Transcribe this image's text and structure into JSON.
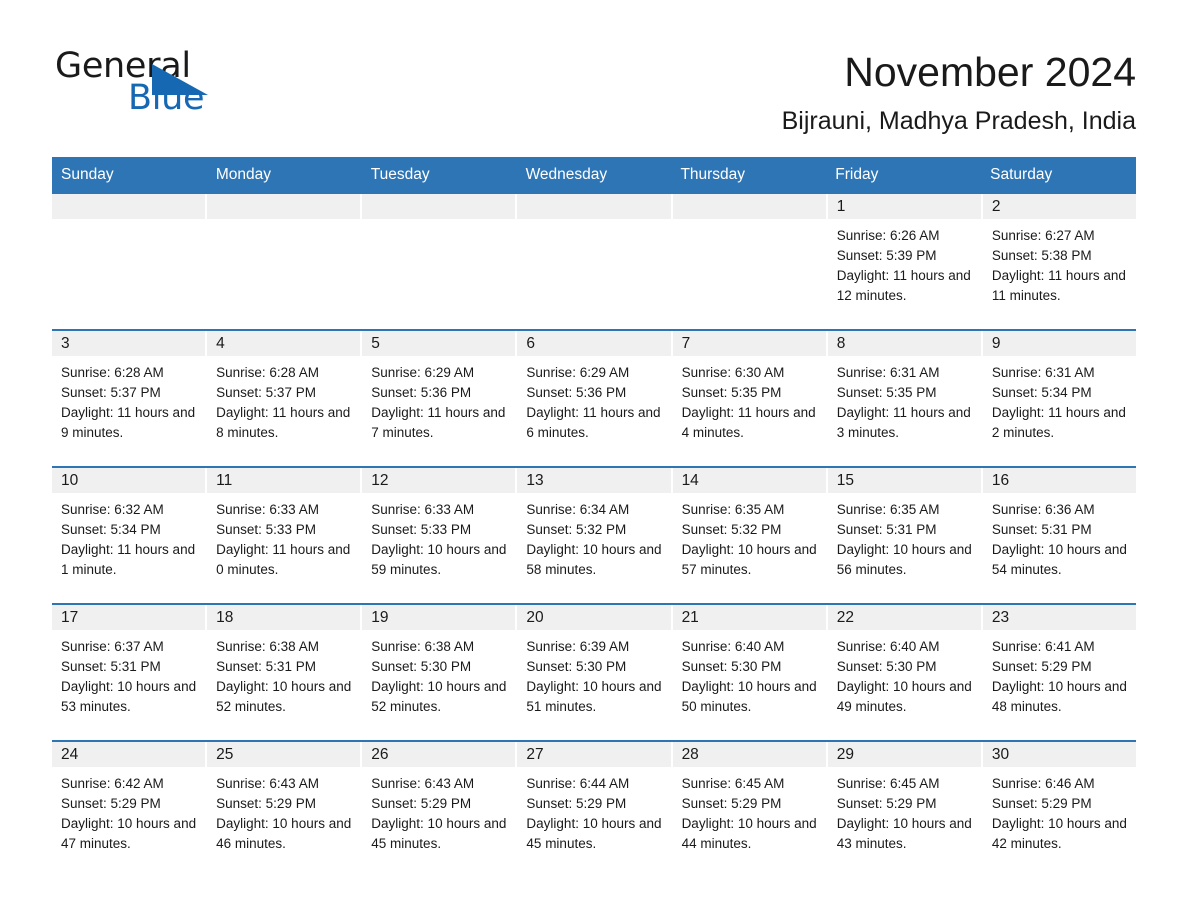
{
  "logo": {
    "word1": "General",
    "word2": "Blue",
    "triangle_color": "#1668b3",
    "icon": "triangle-icon"
  },
  "header": {
    "title": "November 2024",
    "subtitle": "Bijrauni, Madhya Pradesh, India"
  },
  "theme": {
    "header_blue": "#2e75b6",
    "daynum_gray": "#f0f0f0",
    "text": "#1a1a1a"
  },
  "calendar": {
    "weekdays": [
      "Sunday",
      "Monday",
      "Tuesday",
      "Wednesday",
      "Thursday",
      "Friday",
      "Saturday"
    ],
    "labels": {
      "sunrise": "Sunrise:",
      "sunset": "Sunset:",
      "daylight": "Daylight:"
    },
    "weeks": [
      [
        {
          "day": "",
          "sunrise": "",
          "sunset": "",
          "daylight": ""
        },
        {
          "day": "",
          "sunrise": "",
          "sunset": "",
          "daylight": ""
        },
        {
          "day": "",
          "sunrise": "",
          "sunset": "",
          "daylight": ""
        },
        {
          "day": "",
          "sunrise": "",
          "sunset": "",
          "daylight": ""
        },
        {
          "day": "",
          "sunrise": "",
          "sunset": "",
          "daylight": ""
        },
        {
          "day": "1",
          "sunrise": "Sunrise: 6:26 AM",
          "sunset": "Sunset: 5:39 PM",
          "daylight": "Daylight: 11 hours and 12 minutes."
        },
        {
          "day": "2",
          "sunrise": "Sunrise: 6:27 AM",
          "sunset": "Sunset: 5:38 PM",
          "daylight": "Daylight: 11 hours and 11 minutes."
        }
      ],
      [
        {
          "day": "3",
          "sunrise": "Sunrise: 6:28 AM",
          "sunset": "Sunset: 5:37 PM",
          "daylight": "Daylight: 11 hours and 9 minutes."
        },
        {
          "day": "4",
          "sunrise": "Sunrise: 6:28 AM",
          "sunset": "Sunset: 5:37 PM",
          "daylight": "Daylight: 11 hours and 8 minutes."
        },
        {
          "day": "5",
          "sunrise": "Sunrise: 6:29 AM",
          "sunset": "Sunset: 5:36 PM",
          "daylight": "Daylight: 11 hours and 7 minutes."
        },
        {
          "day": "6",
          "sunrise": "Sunrise: 6:29 AM",
          "sunset": "Sunset: 5:36 PM",
          "daylight": "Daylight: 11 hours and 6 minutes."
        },
        {
          "day": "7",
          "sunrise": "Sunrise: 6:30 AM",
          "sunset": "Sunset: 5:35 PM",
          "daylight": "Daylight: 11 hours and 4 minutes."
        },
        {
          "day": "8",
          "sunrise": "Sunrise: 6:31 AM",
          "sunset": "Sunset: 5:35 PM",
          "daylight": "Daylight: 11 hours and 3 minutes."
        },
        {
          "day": "9",
          "sunrise": "Sunrise: 6:31 AM",
          "sunset": "Sunset: 5:34 PM",
          "daylight": "Daylight: 11 hours and 2 minutes."
        }
      ],
      [
        {
          "day": "10",
          "sunrise": "Sunrise: 6:32 AM",
          "sunset": "Sunset: 5:34 PM",
          "daylight": "Daylight: 11 hours and 1 minute."
        },
        {
          "day": "11",
          "sunrise": "Sunrise: 6:33 AM",
          "sunset": "Sunset: 5:33 PM",
          "daylight": "Daylight: 11 hours and 0 minutes."
        },
        {
          "day": "12",
          "sunrise": "Sunrise: 6:33 AM",
          "sunset": "Sunset: 5:33 PM",
          "daylight": "Daylight: 10 hours and 59 minutes."
        },
        {
          "day": "13",
          "sunrise": "Sunrise: 6:34 AM",
          "sunset": "Sunset: 5:32 PM",
          "daylight": "Daylight: 10 hours and 58 minutes."
        },
        {
          "day": "14",
          "sunrise": "Sunrise: 6:35 AM",
          "sunset": "Sunset: 5:32 PM",
          "daylight": "Daylight: 10 hours and 57 minutes."
        },
        {
          "day": "15",
          "sunrise": "Sunrise: 6:35 AM",
          "sunset": "Sunset: 5:31 PM",
          "daylight": "Daylight: 10 hours and 56 minutes."
        },
        {
          "day": "16",
          "sunrise": "Sunrise: 6:36 AM",
          "sunset": "Sunset: 5:31 PM",
          "daylight": "Daylight: 10 hours and 54 minutes."
        }
      ],
      [
        {
          "day": "17",
          "sunrise": "Sunrise: 6:37 AM",
          "sunset": "Sunset: 5:31 PM",
          "daylight": "Daylight: 10 hours and 53 minutes."
        },
        {
          "day": "18",
          "sunrise": "Sunrise: 6:38 AM",
          "sunset": "Sunset: 5:31 PM",
          "daylight": "Daylight: 10 hours and 52 minutes."
        },
        {
          "day": "19",
          "sunrise": "Sunrise: 6:38 AM",
          "sunset": "Sunset: 5:30 PM",
          "daylight": "Daylight: 10 hours and 52 minutes."
        },
        {
          "day": "20",
          "sunrise": "Sunrise: 6:39 AM",
          "sunset": "Sunset: 5:30 PM",
          "daylight": "Daylight: 10 hours and 51 minutes."
        },
        {
          "day": "21",
          "sunrise": "Sunrise: 6:40 AM",
          "sunset": "Sunset: 5:30 PM",
          "daylight": "Daylight: 10 hours and 50 minutes."
        },
        {
          "day": "22",
          "sunrise": "Sunrise: 6:40 AM",
          "sunset": "Sunset: 5:30 PM",
          "daylight": "Daylight: 10 hours and 49 minutes."
        },
        {
          "day": "23",
          "sunrise": "Sunrise: 6:41 AM",
          "sunset": "Sunset: 5:29 PM",
          "daylight": "Daylight: 10 hours and 48 minutes."
        }
      ],
      [
        {
          "day": "24",
          "sunrise": "Sunrise: 6:42 AM",
          "sunset": "Sunset: 5:29 PM",
          "daylight": "Daylight: 10 hours and 47 minutes."
        },
        {
          "day": "25",
          "sunrise": "Sunrise: 6:43 AM",
          "sunset": "Sunset: 5:29 PM",
          "daylight": "Daylight: 10 hours and 46 minutes."
        },
        {
          "day": "26",
          "sunrise": "Sunrise: 6:43 AM",
          "sunset": "Sunset: 5:29 PM",
          "daylight": "Daylight: 10 hours and 45 minutes."
        },
        {
          "day": "27",
          "sunrise": "Sunrise: 6:44 AM",
          "sunset": "Sunset: 5:29 PM",
          "daylight": "Daylight: 10 hours and 45 minutes."
        },
        {
          "day": "28",
          "sunrise": "Sunrise: 6:45 AM",
          "sunset": "Sunset: 5:29 PM",
          "daylight": "Daylight: 10 hours and 44 minutes."
        },
        {
          "day": "29",
          "sunrise": "Sunrise: 6:45 AM",
          "sunset": "Sunset: 5:29 PM",
          "daylight": "Daylight: 10 hours and 43 minutes."
        },
        {
          "day": "30",
          "sunrise": "Sunrise: 6:46 AM",
          "sunset": "Sunset: 5:29 PM",
          "daylight": "Daylight: 10 hours and 42 minutes."
        }
      ]
    ]
  }
}
